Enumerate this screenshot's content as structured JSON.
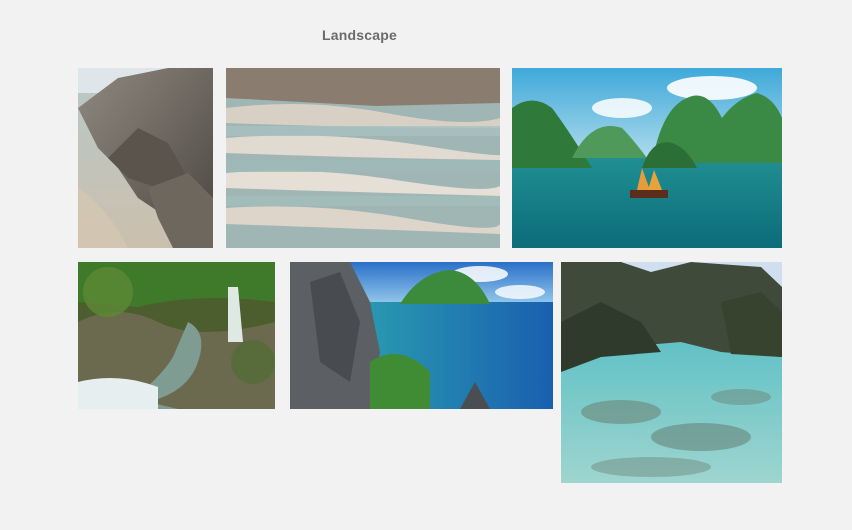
{
  "gallery": {
    "title": "Landscape",
    "photos": [
      {
        "id": "rocky-shore"
      },
      {
        "id": "travertine-terraces"
      },
      {
        "id": "karst-bay-junk-boat"
      },
      {
        "id": "jungle-waterfall"
      },
      {
        "id": "limestone-cliffs-sea"
      },
      {
        "id": "lagoon-reef"
      }
    ]
  }
}
